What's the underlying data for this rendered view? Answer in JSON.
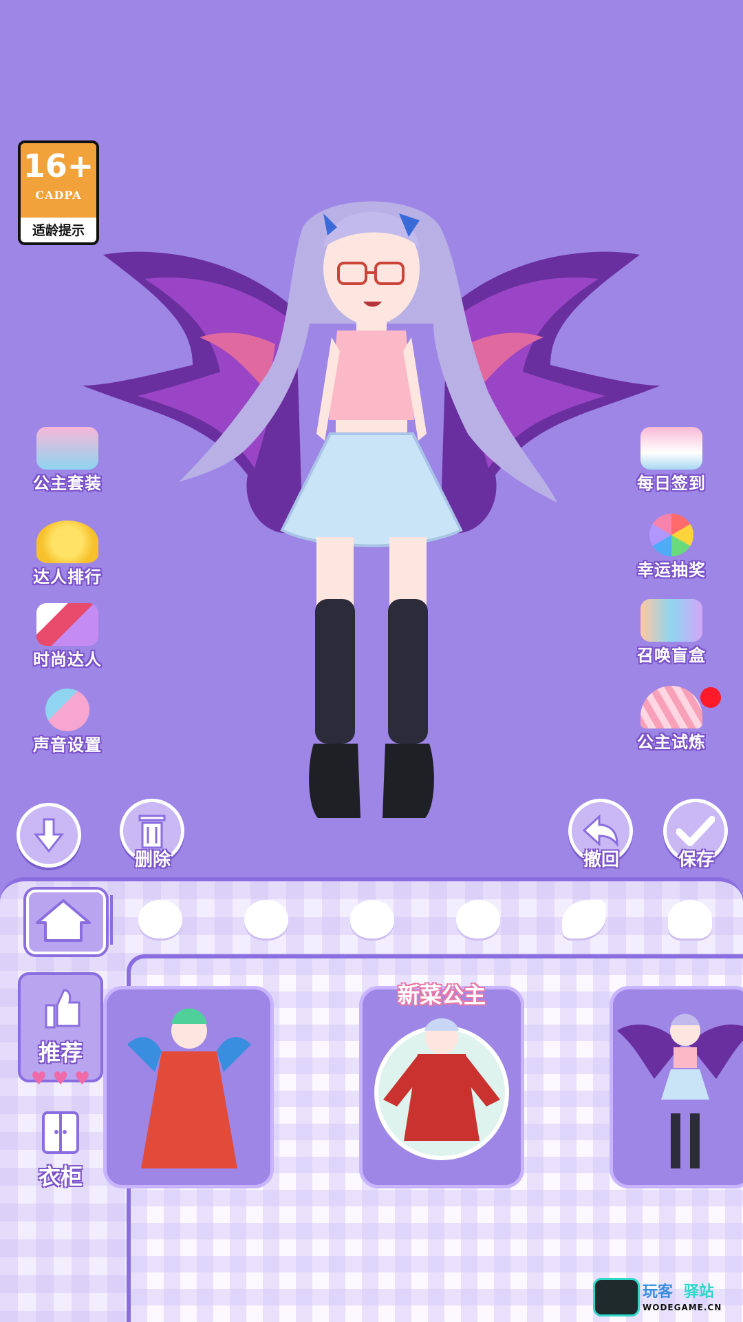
{
  "age_badge": {
    "rating": "16+",
    "org": "CADPA",
    "tip": "适龄提示"
  },
  "left_menu": [
    {
      "label": "公主套装",
      "icon": "dress-icon"
    },
    {
      "label": "达人排行",
      "icon": "crown-icon"
    },
    {
      "label": "时尚达人",
      "icon": "lips-icon"
    },
    {
      "label": "声音设置",
      "icon": "microphone-icon"
    }
  ],
  "right_menu": [
    {
      "label": "每日签到",
      "icon": "calendar-icon"
    },
    {
      "label": "幸运抽奖",
      "icon": "wheel-icon"
    },
    {
      "label": "召唤盲盒",
      "icon": "mystery-box-icon"
    },
    {
      "label": "公主试炼",
      "icon": "fan-icon",
      "badge": true
    }
  ],
  "actions": {
    "delete": "删除",
    "undo": "撤回",
    "save": "保存"
  },
  "categories": {
    "recommend": "推荐",
    "wardrobe": "衣柜"
  },
  "outfits": [
    {
      "name": ""
    },
    {
      "name": "新菜公主"
    },
    {
      "name": ""
    }
  ],
  "watermark": {
    "brand": "玩客",
    "brand2": "驿站",
    "domain": "WODEGAME.CN"
  },
  "colors": {
    "background": "#9d86e6",
    "accent": "#8a6ee0",
    "badge_orange": "#f2a23b",
    "notify_red": "#ff1a2a"
  }
}
